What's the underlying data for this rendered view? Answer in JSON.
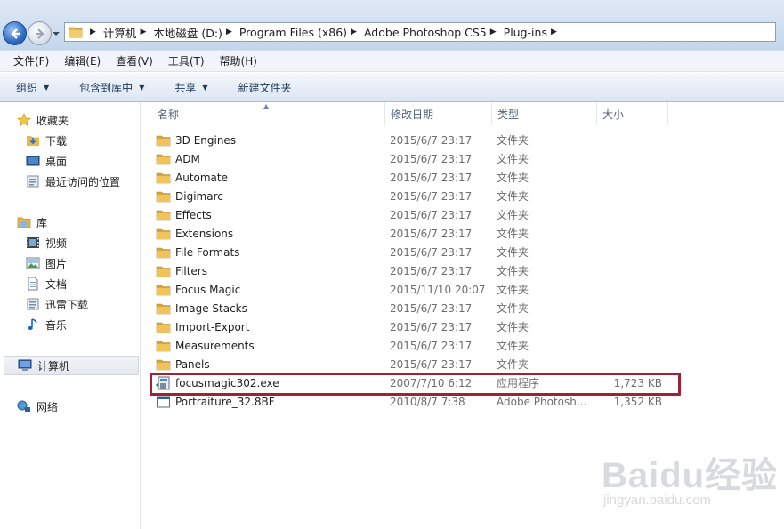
{
  "address": {
    "crumbs": [
      "计算机",
      "本地磁盘 (D:)",
      "Program Files (x86)",
      "Adobe Photoshop CS5",
      "Plug-ins"
    ]
  },
  "menu": [
    "文件(F)",
    "编辑(E)",
    "查看(V)",
    "工具(T)",
    "帮助(H)"
  ],
  "commands": [
    {
      "label": "组织",
      "dropdown": true
    },
    {
      "label": "包含到库中",
      "dropdown": true
    },
    {
      "label": "共享",
      "dropdown": true
    },
    {
      "label": "新建文件夹",
      "dropdown": false
    }
  ],
  "nav": {
    "favorites": {
      "label": "收藏夹",
      "items": [
        "下载",
        "桌面",
        "最近访问的位置"
      ]
    },
    "libraries": {
      "label": "库",
      "items": [
        "视频",
        "图片",
        "文档",
        "迅雷下载",
        "音乐"
      ]
    },
    "computer": "计算机",
    "network": "网络"
  },
  "columns": {
    "name": "名称",
    "date": "修改日期",
    "type": "类型",
    "size": "大小"
  },
  "files": [
    {
      "name": "3D Engines",
      "date": "2015/6/7 23:17",
      "type": "文件夹",
      "size": "",
      "icon": "folder"
    },
    {
      "name": "ADM",
      "date": "2015/6/7 23:17",
      "type": "文件夹",
      "size": "",
      "icon": "folder"
    },
    {
      "name": "Automate",
      "date": "2015/6/7 23:17",
      "type": "文件夹",
      "size": "",
      "icon": "folder"
    },
    {
      "name": "Digimarc",
      "date": "2015/6/7 23:17",
      "type": "文件夹",
      "size": "",
      "icon": "folder"
    },
    {
      "name": "Effects",
      "date": "2015/6/7 23:17",
      "type": "文件夹",
      "size": "",
      "icon": "folder"
    },
    {
      "name": "Extensions",
      "date": "2015/6/7 23:17",
      "type": "文件夹",
      "size": "",
      "icon": "folder"
    },
    {
      "name": "File Formats",
      "date": "2015/6/7 23:17",
      "type": "文件夹",
      "size": "",
      "icon": "folder"
    },
    {
      "name": "Filters",
      "date": "2015/6/7 23:17",
      "type": "文件夹",
      "size": "",
      "icon": "folder"
    },
    {
      "name": "Focus Magic",
      "date": "2015/11/10 20:07",
      "type": "文件夹",
      "size": "",
      "icon": "folder"
    },
    {
      "name": "Image Stacks",
      "date": "2015/6/7 23:17",
      "type": "文件夹",
      "size": "",
      "icon": "folder"
    },
    {
      "name": "Import-Export",
      "date": "2015/6/7 23:17",
      "type": "文件夹",
      "size": "",
      "icon": "folder"
    },
    {
      "name": "Measurements",
      "date": "2015/6/7 23:17",
      "type": "文件夹",
      "size": "",
      "icon": "folder"
    },
    {
      "name": "Panels",
      "date": "2015/6/7 23:17",
      "type": "文件夹",
      "size": "",
      "icon": "folder"
    },
    {
      "name": "focusmagic302.exe",
      "date": "2007/7/10 6:12",
      "type": "应用程序",
      "size": "1,723 KB",
      "icon": "installer"
    },
    {
      "name": "Portraiture_32.8BF",
      "date": "2010/8/7 7:38",
      "type": "Adobe Photosh...",
      "size": "1,352 KB",
      "icon": "plugin"
    }
  ],
  "watermark": {
    "logo": "Baidu经验",
    "url": "jingyan.baidu.com"
  },
  "colors": {
    "highlight": "#a21f34",
    "folder": "#e8b84a"
  }
}
